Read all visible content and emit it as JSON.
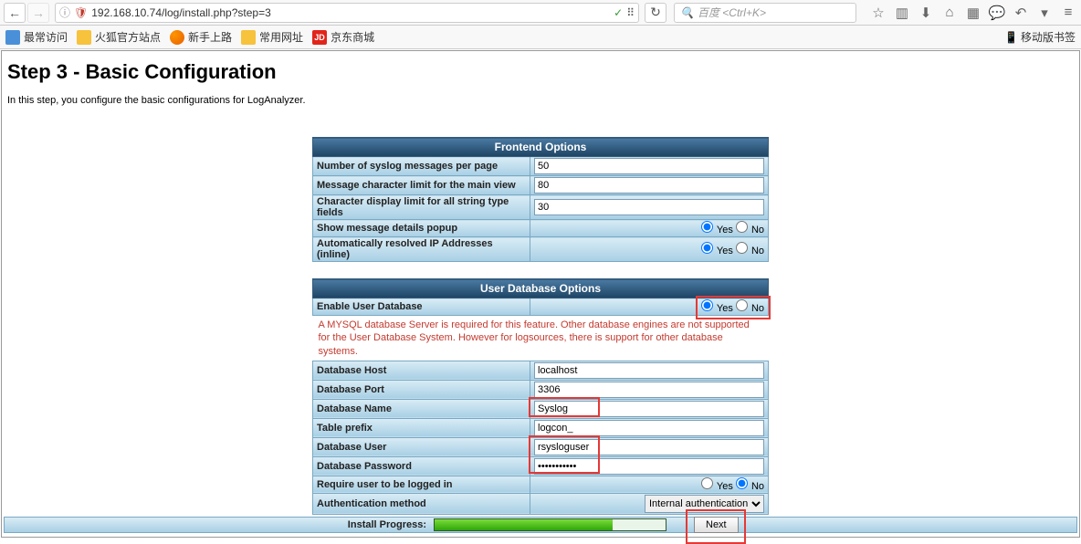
{
  "browser": {
    "url": "192.168.10.74/log/install.php?step=3",
    "search_placeholder": "百度 <Ctrl+K>"
  },
  "bookmarks": [
    {
      "label": "最常访问",
      "icon": "blue"
    },
    {
      "label": "火狐官方站点",
      "icon": "folder"
    },
    {
      "label": "新手上路",
      "icon": "ff"
    },
    {
      "label": "常用网址",
      "icon": "folder"
    },
    {
      "label": "京东商城",
      "icon": "jd"
    }
  ],
  "mobile_label": "移动版书签",
  "page": {
    "title": "Step 3 - Basic Configuration",
    "description": "In this step, you configure the basic configurations for LogAnalyzer."
  },
  "frontend": {
    "header": "Frontend Options",
    "num_msgs_label": "Number of syslog messages per page",
    "num_msgs_value": "50",
    "msg_limit_label": "Message character limit for the main view",
    "msg_limit_value": "80",
    "char_limit_label": "Character display limit for all string type fields",
    "char_limit_value": "30",
    "show_popup_label": "Show message details popup",
    "auto_resolve_label": "Automatically resolved IP Addresses (inline)",
    "yes": "Yes",
    "no": "No"
  },
  "userdb": {
    "header": "User Database Options",
    "enable_label": "Enable User Database",
    "note": "A MYSQL database Server is required for this feature. Other database engines are not supported for the User Database System. However for logsources, there is support for other database systems.",
    "host_label": "Database Host",
    "host_value": "localhost",
    "port_label": "Database Port",
    "port_value": "3306",
    "name_label": "Database Name",
    "name_value": "Syslog",
    "prefix_label": "Table prefix",
    "prefix_value": "logcon_",
    "user_label": "Database User",
    "user_value": "rsysloguser",
    "pass_label": "Database Password",
    "pass_value": "•••••••••••",
    "require_login_label": "Require user to be logged in",
    "auth_label": "Authentication method",
    "auth_value": "Internal authentication",
    "yes": "Yes",
    "no": "No"
  },
  "progress": {
    "label": "Install Progress:",
    "percent": 77,
    "next": "Next"
  }
}
